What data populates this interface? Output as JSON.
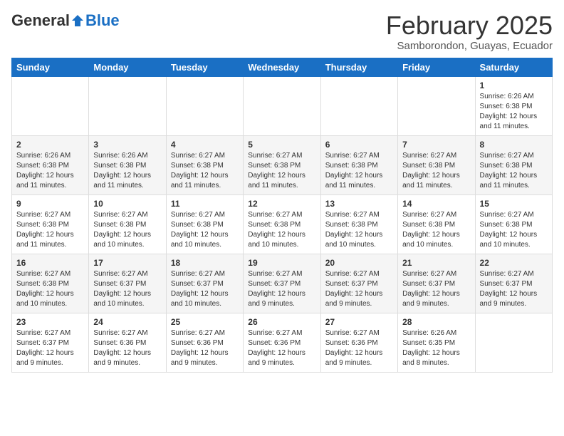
{
  "header": {
    "logo_general": "General",
    "logo_blue": "Blue",
    "month_title": "February 2025",
    "location": "Samborondon, Guayas, Ecuador"
  },
  "days_of_week": [
    "Sunday",
    "Monday",
    "Tuesday",
    "Wednesday",
    "Thursday",
    "Friday",
    "Saturday"
  ],
  "weeks": [
    [
      {
        "day": "",
        "info": ""
      },
      {
        "day": "",
        "info": ""
      },
      {
        "day": "",
        "info": ""
      },
      {
        "day": "",
        "info": ""
      },
      {
        "day": "",
        "info": ""
      },
      {
        "day": "",
        "info": ""
      },
      {
        "day": "1",
        "info": "Sunrise: 6:26 AM\nSunset: 6:38 PM\nDaylight: 12 hours and 11 minutes."
      }
    ],
    [
      {
        "day": "2",
        "info": "Sunrise: 6:26 AM\nSunset: 6:38 PM\nDaylight: 12 hours and 11 minutes."
      },
      {
        "day": "3",
        "info": "Sunrise: 6:26 AM\nSunset: 6:38 PM\nDaylight: 12 hours and 11 minutes."
      },
      {
        "day": "4",
        "info": "Sunrise: 6:27 AM\nSunset: 6:38 PM\nDaylight: 12 hours and 11 minutes."
      },
      {
        "day": "5",
        "info": "Sunrise: 6:27 AM\nSunset: 6:38 PM\nDaylight: 12 hours and 11 minutes."
      },
      {
        "day": "6",
        "info": "Sunrise: 6:27 AM\nSunset: 6:38 PM\nDaylight: 12 hours and 11 minutes."
      },
      {
        "day": "7",
        "info": "Sunrise: 6:27 AM\nSunset: 6:38 PM\nDaylight: 12 hours and 11 minutes."
      },
      {
        "day": "8",
        "info": "Sunrise: 6:27 AM\nSunset: 6:38 PM\nDaylight: 12 hours and 11 minutes."
      }
    ],
    [
      {
        "day": "9",
        "info": "Sunrise: 6:27 AM\nSunset: 6:38 PM\nDaylight: 12 hours and 11 minutes."
      },
      {
        "day": "10",
        "info": "Sunrise: 6:27 AM\nSunset: 6:38 PM\nDaylight: 12 hours and 10 minutes."
      },
      {
        "day": "11",
        "info": "Sunrise: 6:27 AM\nSunset: 6:38 PM\nDaylight: 12 hours and 10 minutes."
      },
      {
        "day": "12",
        "info": "Sunrise: 6:27 AM\nSunset: 6:38 PM\nDaylight: 12 hours and 10 minutes."
      },
      {
        "day": "13",
        "info": "Sunrise: 6:27 AM\nSunset: 6:38 PM\nDaylight: 12 hours and 10 minutes."
      },
      {
        "day": "14",
        "info": "Sunrise: 6:27 AM\nSunset: 6:38 PM\nDaylight: 12 hours and 10 minutes."
      },
      {
        "day": "15",
        "info": "Sunrise: 6:27 AM\nSunset: 6:38 PM\nDaylight: 12 hours and 10 minutes."
      }
    ],
    [
      {
        "day": "16",
        "info": "Sunrise: 6:27 AM\nSunset: 6:38 PM\nDaylight: 12 hours and 10 minutes."
      },
      {
        "day": "17",
        "info": "Sunrise: 6:27 AM\nSunset: 6:37 PM\nDaylight: 12 hours and 10 minutes."
      },
      {
        "day": "18",
        "info": "Sunrise: 6:27 AM\nSunset: 6:37 PM\nDaylight: 12 hours and 10 minutes."
      },
      {
        "day": "19",
        "info": "Sunrise: 6:27 AM\nSunset: 6:37 PM\nDaylight: 12 hours and 9 minutes."
      },
      {
        "day": "20",
        "info": "Sunrise: 6:27 AM\nSunset: 6:37 PM\nDaylight: 12 hours and 9 minutes."
      },
      {
        "day": "21",
        "info": "Sunrise: 6:27 AM\nSunset: 6:37 PM\nDaylight: 12 hours and 9 minutes."
      },
      {
        "day": "22",
        "info": "Sunrise: 6:27 AM\nSunset: 6:37 PM\nDaylight: 12 hours and 9 minutes."
      }
    ],
    [
      {
        "day": "23",
        "info": "Sunrise: 6:27 AM\nSunset: 6:37 PM\nDaylight: 12 hours and 9 minutes."
      },
      {
        "day": "24",
        "info": "Sunrise: 6:27 AM\nSunset: 6:36 PM\nDaylight: 12 hours and 9 minutes."
      },
      {
        "day": "25",
        "info": "Sunrise: 6:27 AM\nSunset: 6:36 PM\nDaylight: 12 hours and 9 minutes."
      },
      {
        "day": "26",
        "info": "Sunrise: 6:27 AM\nSunset: 6:36 PM\nDaylight: 12 hours and 9 minutes."
      },
      {
        "day": "27",
        "info": "Sunrise: 6:27 AM\nSunset: 6:36 PM\nDaylight: 12 hours and 9 minutes."
      },
      {
        "day": "28",
        "info": "Sunrise: 6:26 AM\nSunset: 6:35 PM\nDaylight: 12 hours and 8 minutes."
      },
      {
        "day": "",
        "info": ""
      }
    ]
  ]
}
